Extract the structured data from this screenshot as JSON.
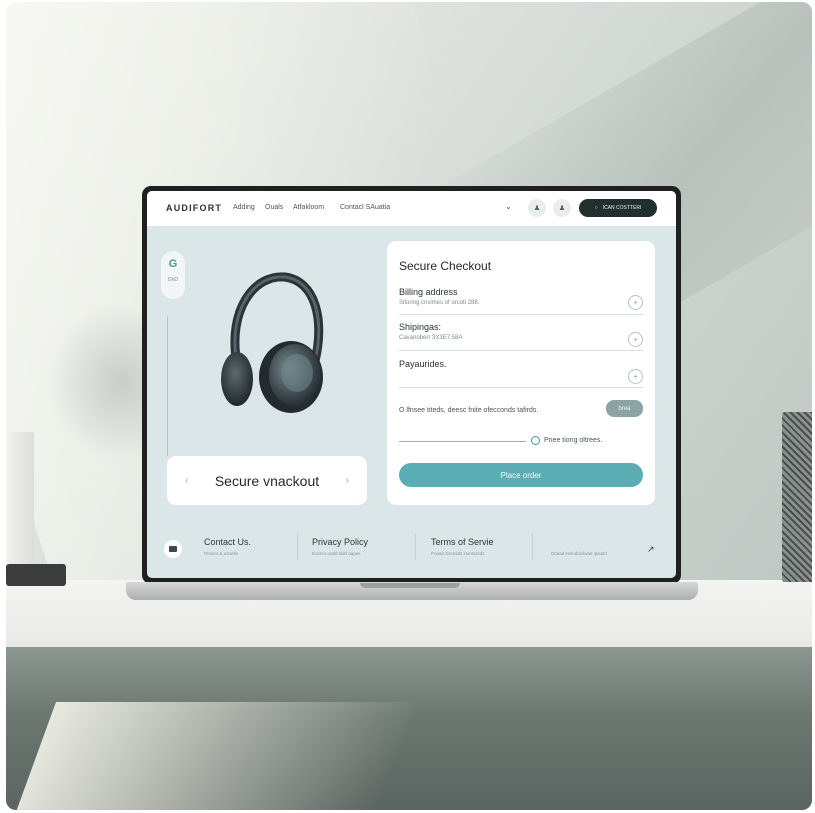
{
  "nav": {
    "brand": "AUDIFORT",
    "links": [
      "Adding",
      "Ouals",
      "Atfakloom",
      "Contacl SAuatia"
    ],
    "cta_label": "ICAN COSTTERI"
  },
  "side": {
    "label": "DnD"
  },
  "product_card": {
    "label": "Secure vnackout"
  },
  "checkout": {
    "title": "Secure Checkout",
    "billing_label": "Billing address",
    "billing_value": "Sitoring cnsimes of orcoti 288.",
    "shipping_label": "Shipingas:",
    "shipping_value": "Cavanoberr 3X3E7.58A",
    "payment_label": "Payaurides.",
    "notice": "O lfnsee titeds, deesc fnite ofecconds tafirds.",
    "mini_button": "brea",
    "radio_label": "Pnee tiong oltrees.",
    "place_order": "Place order"
  },
  "footer": {
    "items": [
      {
        "title": "Contact Us.",
        "sub": "Pnoers & usnelle"
      },
      {
        "title": "Privacy Policy",
        "sub": "Eosreo.oodd tiidd oapes"
      },
      {
        "title": "Terms of Servie",
        "sub": "Ponait Sosesds Huotsssds"
      },
      {
        "title": "",
        "sub": "Dnead Holodclekvae ipsutid"
      }
    ]
  },
  "colors": {
    "accent": "#5aaeb3",
    "nav_cta": "#21302e",
    "screen_bg": "#dbe6e8"
  }
}
